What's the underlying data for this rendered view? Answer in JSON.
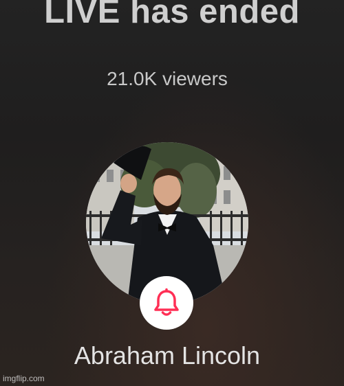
{
  "live": {
    "status_title": "LIVE has ended",
    "viewers_text": "21.0K viewers"
  },
  "host": {
    "name": "Abraham Lincoln",
    "avatar_icon": "profile-photo",
    "follow_icon": "bell-icon"
  },
  "watermark": {
    "text": "imgflip.com"
  },
  "colors": {
    "bell_accent": "#ff2f55",
    "bell_bg": "#ffffff"
  }
}
